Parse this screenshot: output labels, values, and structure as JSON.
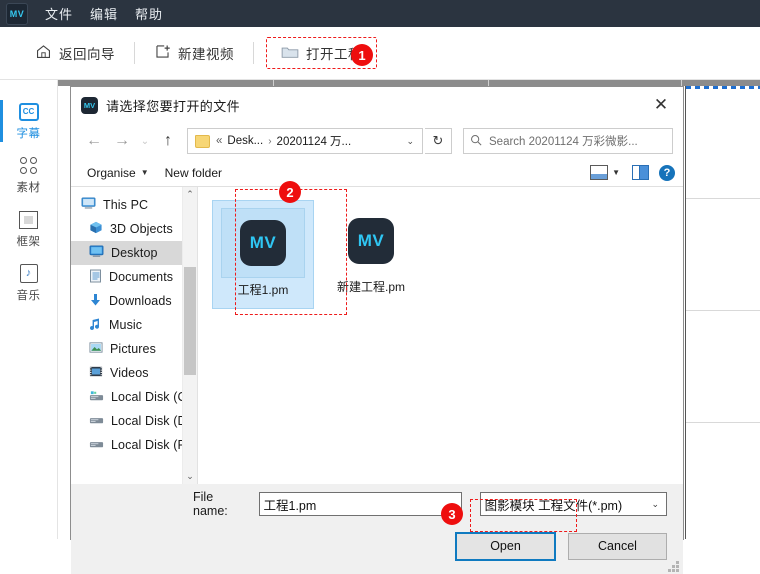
{
  "app": {
    "logo": "MV",
    "menu": [
      "文件",
      "编辑",
      "帮助"
    ],
    "toolbar": {
      "back_label": "返回向导",
      "new_video_label": "新建视频",
      "open_project_label": "打开工程"
    },
    "sidebar": [
      {
        "label": "字幕",
        "icon": "cc-icon",
        "active": true
      },
      {
        "label": "素材",
        "icon": "grid-icon",
        "active": false
      },
      {
        "label": "框架",
        "icon": "frame-icon",
        "active": false
      },
      {
        "label": "音乐",
        "icon": "music-icon",
        "active": false
      }
    ]
  },
  "dialog": {
    "title": "请选择您要打开的文件",
    "title_icon": "MV",
    "close_icon": "✕",
    "nav": {
      "back_icon": "←",
      "forward_icon": "→",
      "history_icon": "⌄",
      "up_icon": "↑",
      "refresh_icon": "↻",
      "crumb_chevrons": "«",
      "crumb_segments": [
        "Desk...",
        "20201124 万..."
      ],
      "crumb_separator": "›",
      "crumb_caret": "⌄"
    },
    "search": {
      "placeholder": "Search 20201124 万彩微影...",
      "icon": "search-icon"
    },
    "commandbar": {
      "organise_label": "Organise",
      "organise_caret": "▼",
      "new_folder_label": "New folder",
      "view_caret": "▼",
      "help_label": "?"
    },
    "tree": [
      {
        "label": "This PC",
        "icon": "pc-icon",
        "selected": false,
        "level": 0
      },
      {
        "label": "3D Objects",
        "icon": "3d-icon",
        "selected": false,
        "level": 1
      },
      {
        "label": "Desktop",
        "icon": "desktop-icon",
        "selected": true,
        "level": 1
      },
      {
        "label": "Documents",
        "icon": "documents-icon",
        "selected": false,
        "level": 1
      },
      {
        "label": "Downloads",
        "icon": "downloads-icon",
        "selected": false,
        "level": 1
      },
      {
        "label": "Music",
        "icon": "music-icon",
        "selected": false,
        "level": 1
      },
      {
        "label": "Pictures",
        "icon": "pictures-icon",
        "selected": false,
        "level": 1
      },
      {
        "label": "Videos",
        "icon": "videos-icon",
        "selected": false,
        "level": 1
      },
      {
        "label": "Local Disk (C:)",
        "icon": "disk-icon",
        "selected": false,
        "level": 1
      },
      {
        "label": "Local Disk (D:)",
        "icon": "disk-icon",
        "selected": false,
        "level": 1
      },
      {
        "label": "Local Disk (F:)",
        "icon": "disk-icon",
        "selected": false,
        "level": 1
      }
    ],
    "scroll": {
      "up_arrow": "⌃",
      "down_arrow": "⌄"
    },
    "files": [
      {
        "name": "工程1.pm",
        "icon": "MV",
        "selected": true
      },
      {
        "name": "新建工程.pm",
        "icon": "MV",
        "selected": false
      }
    ],
    "footer": {
      "filename_label": "File name:",
      "filename_value": "工程1.pm",
      "filename_caret": "⌄",
      "filetype_value": "图影模块 工程文件(*.pm)",
      "filetype_caret": "⌄",
      "open_label": "Open",
      "cancel_label": "Cancel"
    }
  },
  "annotations": [
    {
      "id": "1",
      "label": "1"
    },
    {
      "id": "2",
      "label": "2"
    },
    {
      "id": "3",
      "label": "3"
    }
  ],
  "colors": {
    "accent": "#1f8fe0",
    "menubar": "#2b3440",
    "annotation_red": "#ee0e0e",
    "mv_cyan": "#2fc6f3",
    "selection_blue": "#cfe8fb"
  }
}
